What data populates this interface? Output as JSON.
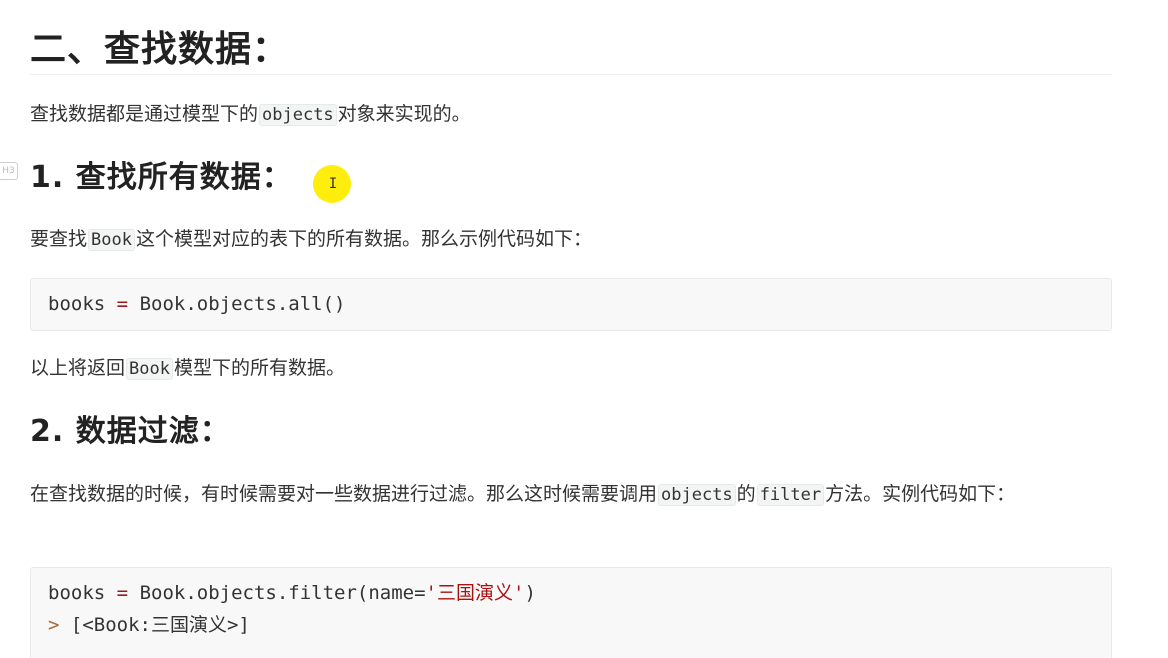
{
  "heading": {
    "title": "二、查找数据："
  },
  "intro": {
    "before": "查找数据都是通过模型下的",
    "code": "objects",
    "after": "对象来实现的。"
  },
  "section1": {
    "title": "1. 查找所有数据：",
    "gutter_label": "H3",
    "desc_before": "要查找",
    "desc_code": "Book",
    "desc_after": "这个模型对应的表下的所有数据。那么示例代码如下：",
    "code": {
      "var": "books",
      "eq": "=",
      "expr": "Book.objects.all()"
    },
    "result_before": "以上将返回",
    "result_code": "Book",
    "result_after": "模型下的所有数据。"
  },
  "section2": {
    "title": "2. 数据过滤：",
    "desc_part1": "在查找数据的时候，有时候需要对一些数据进行过滤。那么这时候需要调用",
    "desc_code1": "objects",
    "desc_part2": "的",
    "desc_code2": "filter",
    "desc_part3": "方法。实例代码如下：",
    "code": {
      "var": "books",
      "eq": "=",
      "call_start": "Book.objects.filter(name=",
      "string": "'三国演义'",
      "call_end": ")",
      "prompt": ">",
      "output": "[<Book:三国演义>]"
    }
  },
  "cursor": {
    "icon": "text-cursor-icon",
    "glyph": "I",
    "highlight_color": "#ffec00"
  }
}
